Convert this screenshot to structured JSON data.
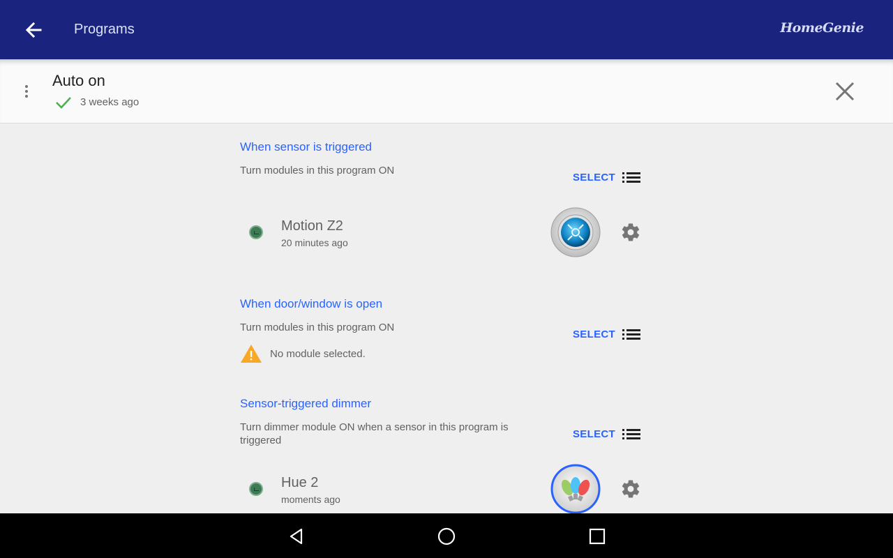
{
  "appbar": {
    "title": "Programs",
    "brand": "HomeGenie",
    "back_icon": "arrow-back-icon",
    "color": "#1a237e"
  },
  "program": {
    "name": "Auto on",
    "status_icon": "checkmark-icon",
    "status_color": "#4caf50",
    "last_run": "3 weeks ago"
  },
  "sections": [
    {
      "title": "When sensor is triggered",
      "description": "Turn modules in this program ON",
      "select_label": "SELECT",
      "module": {
        "name": "Motion Z2",
        "time": "20 minutes ago",
        "icon": "motion-sensor-icon"
      }
    },
    {
      "title": "When door/window is open",
      "description": "Turn modules in this program ON",
      "select_label": "SELECT",
      "warning": "No module selected."
    },
    {
      "title": "Sensor-triggered dimmer",
      "description": "Turn dimmer module ON when a sensor in this program is triggered",
      "select_label": "SELECT",
      "module": {
        "name": "Hue 2",
        "time": "moments ago",
        "icon": "color-bulbs-icon"
      }
    }
  ],
  "accent_color": "#2962ff",
  "navbar": {
    "icons": [
      "nav-back-icon",
      "nav-home-icon",
      "nav-recents-icon"
    ]
  }
}
